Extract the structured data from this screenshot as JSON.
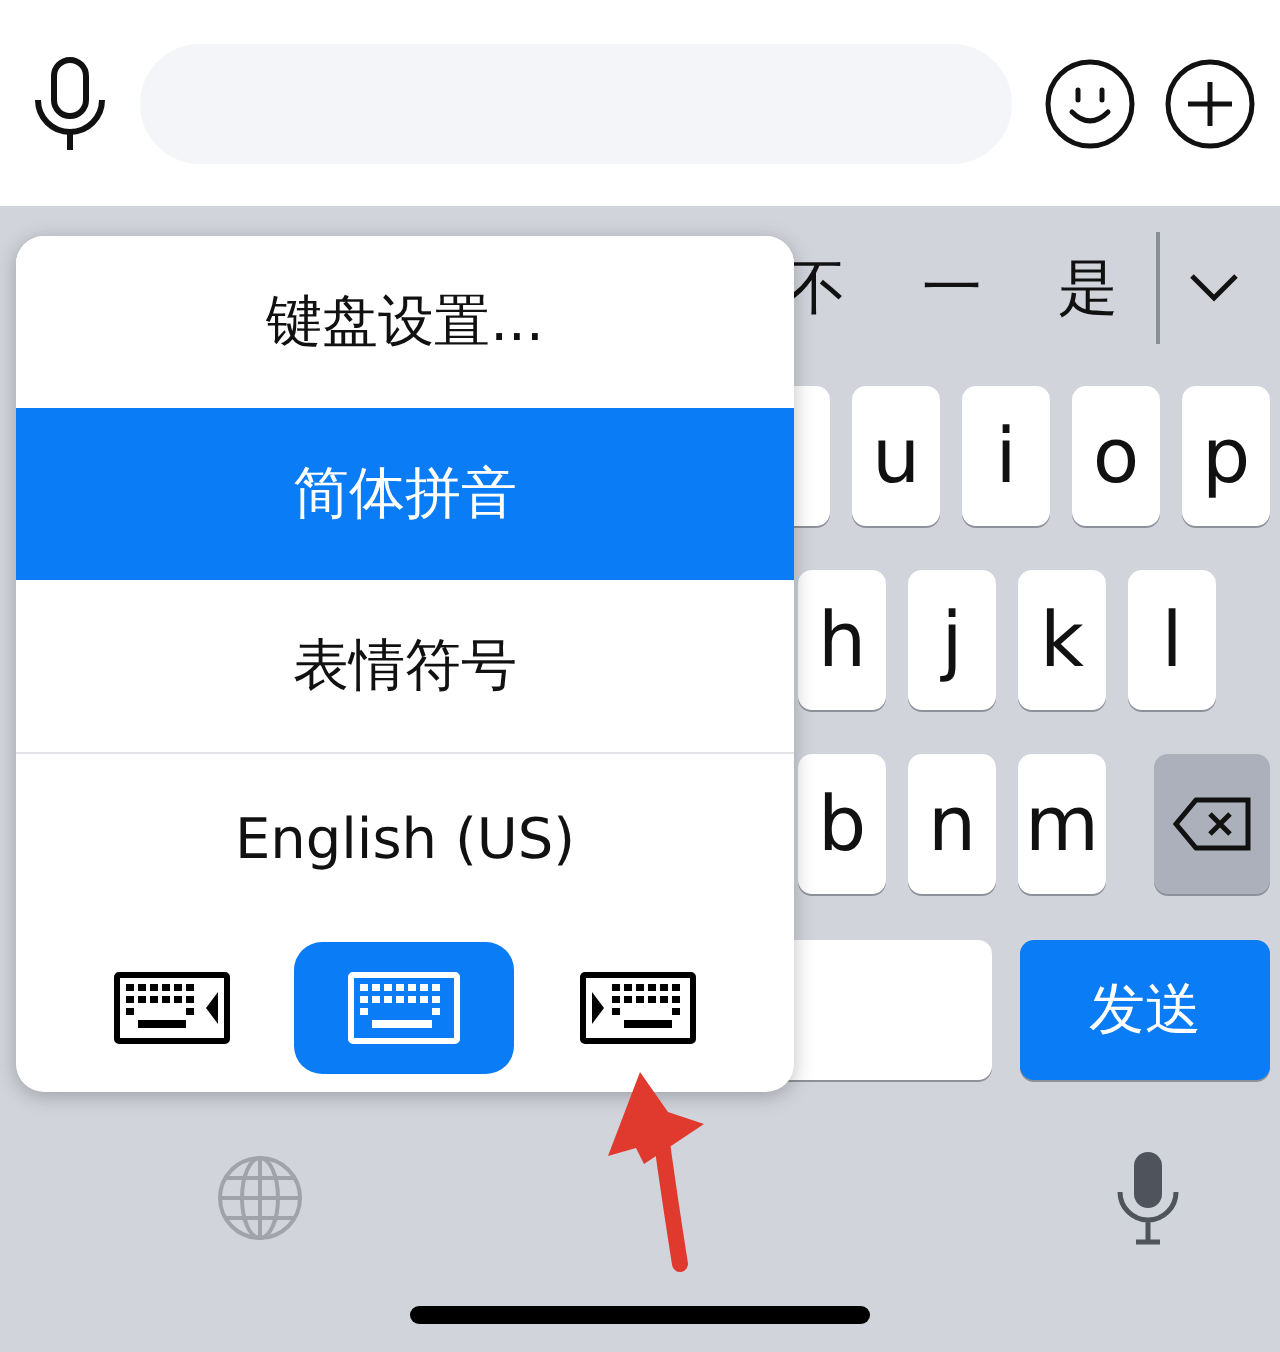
{
  "candidates": [
    "不",
    "一",
    "是"
  ],
  "keyboard": {
    "rows": [
      [
        "u",
        "i",
        "o",
        "p"
      ],
      [
        "h",
        "j",
        "k",
        "l"
      ],
      [
        "b",
        "n",
        "m"
      ]
    ],
    "send_label": "发送"
  },
  "popup": {
    "items": [
      {
        "label": "键盘设置...",
        "selected": false
      },
      {
        "label": "简体拼音",
        "selected": true
      },
      {
        "label": "表情符号",
        "selected": false
      },
      {
        "label": "English (US)",
        "selected": false
      }
    ],
    "layouts": [
      {
        "kind": "left",
        "selected": false
      },
      {
        "kind": "full",
        "selected": true
      },
      {
        "kind": "right",
        "selected": false
      }
    ]
  }
}
